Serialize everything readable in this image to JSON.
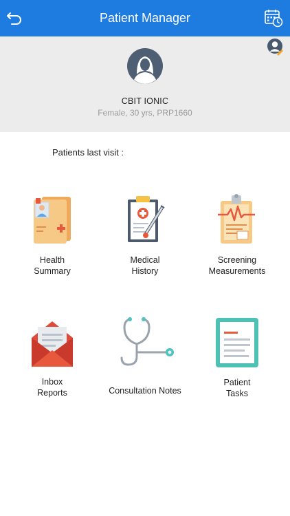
{
  "header": {
    "title": "Patient Manager",
    "back_icon": "back-arrow-icon",
    "calendar_icon": "calendar-clock-icon",
    "color": "#1e7be0"
  },
  "patient": {
    "name": "CBIT IONIC",
    "details": "Female, 30 yrs, PRP1660",
    "avatar_icon": "female-avatar-icon",
    "edit_icon": "edit-profile-icon"
  },
  "section": {
    "last_visit_label": "Patients last visit :"
  },
  "menu": [
    {
      "label": "Health\nSummary",
      "icon": "health-summary-folder-icon"
    },
    {
      "label": "Medical\nHistory",
      "icon": "medical-history-clipboard-icon"
    },
    {
      "label": "Screening\nMeasurements",
      "icon": "screening-measurements-clipboard-icon"
    },
    {
      "label": "Inbox\nReports",
      "icon": "inbox-envelope-icon"
    },
    {
      "label": "Consultation Notes",
      "icon": "stethoscope-icon"
    },
    {
      "label": "Patient\nTasks",
      "icon": "tasks-clipboard-icon"
    }
  ]
}
